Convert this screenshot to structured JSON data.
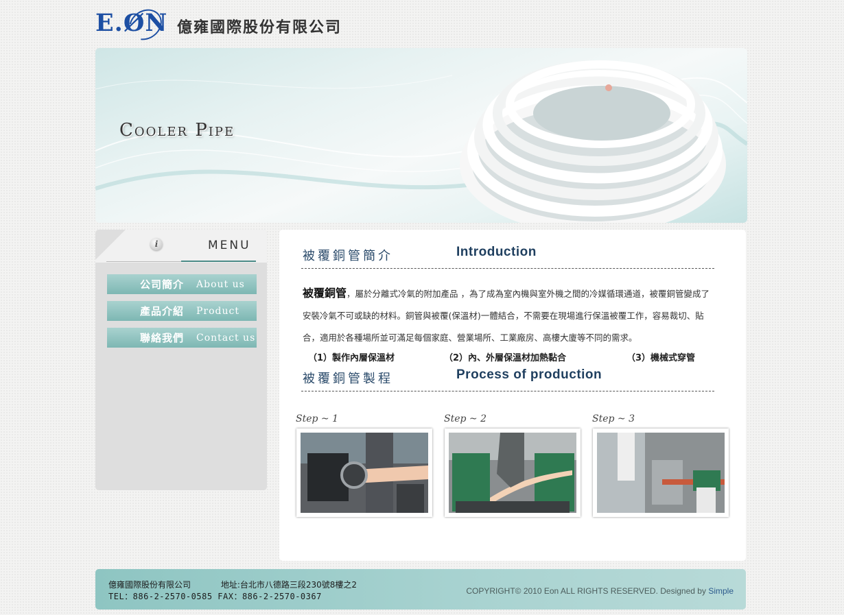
{
  "header": {
    "logo_text": "E.ØN",
    "company_name": "億雍國際股份有限公司"
  },
  "banner": {
    "title": "Cooler Pipe"
  },
  "sidebar": {
    "menu_title": "MENU",
    "items": [
      {
        "zh": "公司簡介",
        "en": "About us"
      },
      {
        "zh": "產品介紹",
        "en": "Product"
      },
      {
        "zh": "聯絡我們",
        "en": "Contact us"
      }
    ]
  },
  "intro": {
    "heading_zh": "被覆銅管簡介",
    "heading_en": "Introduction",
    "lead": "被覆銅管",
    "body": "，屬於分離式冷氣的附加產品 ，為了成為室內機與室外機之間的冷媒循環通道，被覆銅管變成了安裝冷氣不可或缺的材料。銅管與被覆(保溫材)一體結合，不需要在現場進行保溫被覆工作，容易裁切、貼合，適用於各種場所並可滿足每個家庭、營業場所、工業廠房、高樓大廈等不同的需求。"
  },
  "process": {
    "heading_zh": "被覆銅管製程",
    "heading_en": "Process of production",
    "steps": [
      {
        "label": "Step ~ 1",
        "caption": "（1）製作內層保溫材"
      },
      {
        "label": "Step ~ 2",
        "caption": "（2）內、外層保溫材加熱黏合"
      },
      {
        "label": "Step ~ 3",
        "caption": "（3）機械式穿管"
      }
    ]
  },
  "footer": {
    "company": "億雍國際股份有限公司",
    "address": "地址:台北市八德路三段230號8樓之2",
    "phone_fax": "TEL：886-2-2570-0585   FAX：886-2-2570-0367",
    "copyright": "COPYRIGHT© 2010 Eon ALL RIGHTS RESERVED.  Designed by ",
    "designer": "Simple"
  },
  "colors": {
    "accent": "#7db7b3",
    "footer": "#a9d3d1",
    "heading": "#1f3f5f"
  }
}
